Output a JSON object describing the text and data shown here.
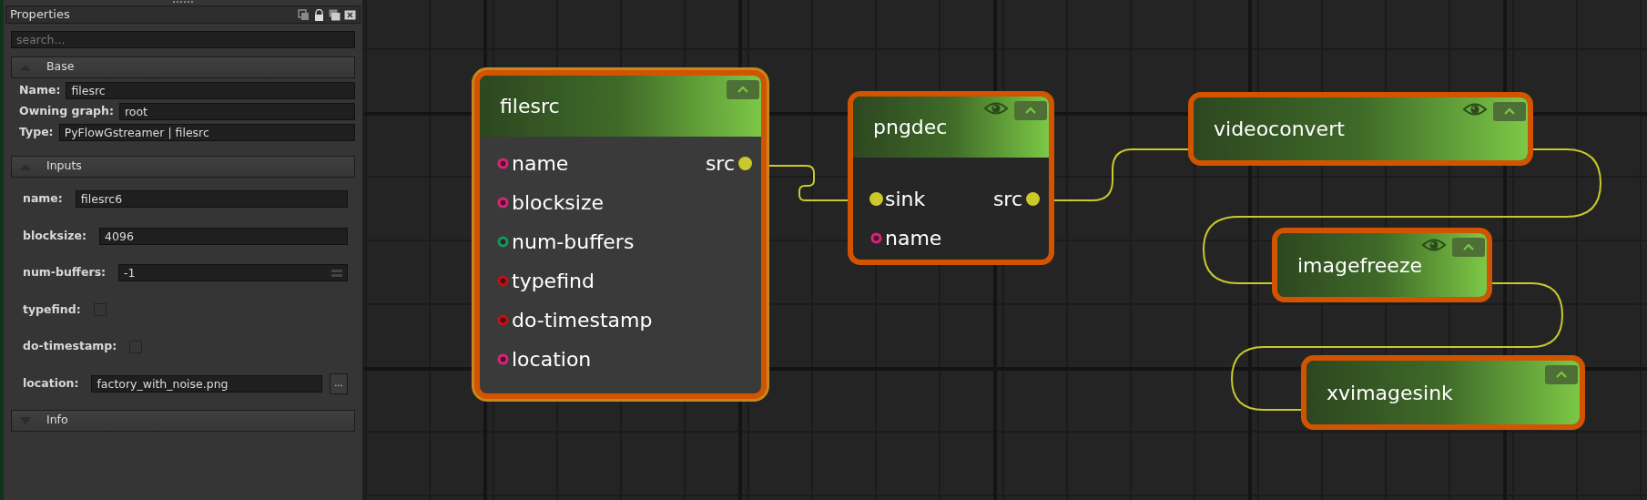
{
  "panel": {
    "title": "Properties",
    "search": {
      "placeholder": "search..."
    },
    "sections": [
      {
        "title": "Base",
        "expanded": true,
        "rows": [
          {
            "kind": "text",
            "label": "Name:",
            "value": "filesrc"
          },
          {
            "kind": "text",
            "label": "Owning graph:",
            "value": "root"
          },
          {
            "kind": "text",
            "label": "Type:",
            "value": "PyFlowGstreamer | filesrc"
          }
        ]
      },
      {
        "title": "Inputs",
        "expanded": true,
        "rows": [
          {
            "kind": "text",
            "label": "name:",
            "value": "filesrc6"
          },
          {
            "kind": "text",
            "label": "blocksize:",
            "value": "4096"
          },
          {
            "kind": "spin",
            "label": "num-buffers:",
            "value": "-1"
          },
          {
            "kind": "check",
            "label": "typefind:",
            "checked": false
          },
          {
            "kind": "check",
            "label": "do-timestamp:",
            "checked": false
          },
          {
            "kind": "file",
            "label": "location:",
            "value": "factory_with_noise.png",
            "button_label": "..."
          }
        ]
      },
      {
        "title": "Info",
        "expanded": false
      }
    ]
  },
  "graph": {
    "nodes": [
      {
        "title": "filesrc",
        "selected": true,
        "preview": false,
        "inputs": [
          {
            "name": "name",
            "kind": "ring",
            "color": "#d6257a"
          },
          {
            "name": "blocksize",
            "kind": "ring",
            "color": "#d6257a"
          },
          {
            "name": "num-buffers",
            "kind": "ring",
            "color": "#0f9a5a"
          },
          {
            "name": "typefind",
            "kind": "ring",
            "color": "#c4120e"
          },
          {
            "name": "do-timestamp",
            "kind": "ring",
            "color": "#c4120e"
          },
          {
            "name": "location",
            "kind": "ring",
            "color": "#d6257a"
          }
        ],
        "outputs": [
          {
            "name": "src",
            "kind": "dot",
            "color": "#c9c92c"
          }
        ]
      },
      {
        "title": "pngdec",
        "selected": false,
        "preview": true,
        "inputs": [
          {
            "name": "sink",
            "kind": "dot",
            "color": "#c9c92c"
          },
          {
            "name": "name",
            "kind": "ring",
            "color": "#d6257a"
          }
        ],
        "outputs": [
          {
            "name": "src",
            "kind": "dot",
            "color": "#c9c92c"
          }
        ]
      },
      {
        "title": "videoconvert",
        "selected": false,
        "preview": true
      },
      {
        "title": "imagefreeze",
        "selected": false,
        "preview": true
      },
      {
        "title": "xvimagesink",
        "selected": false,
        "preview": false
      }
    ]
  }
}
